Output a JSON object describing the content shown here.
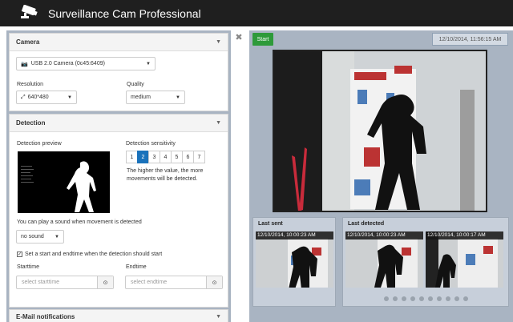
{
  "app": {
    "title": "Surveillance Cam Professional"
  },
  "camera": {
    "header": "Camera",
    "device": "USB 2.0 Camera (0c45:6409)",
    "resolution_label": "Resolution",
    "resolution": "640*480",
    "quality_label": "Quality",
    "quality": "medium"
  },
  "detection": {
    "header": "Detection",
    "preview_label": "Detection preview",
    "sensitivity_label": "Detection sensitivity",
    "sensitivity_options": [
      "1",
      "2",
      "3",
      "4",
      "5",
      "6",
      "7"
    ],
    "sensitivity_selected": "2",
    "hint": "The higher the value, the more movements will be detected.",
    "sound_hint": "You can play a sound when movement is detected",
    "sound": "no sound",
    "checkbox_label": "Set a start and endtime when the detection should start",
    "starttime_label": "Starttime",
    "starttime_placeholder": "select starttime",
    "endtime_label": "Endtime",
    "endtime_placeholder": "select endtime"
  },
  "email": {
    "header": "E-Mail notifications"
  },
  "live": {
    "start_label": "Start",
    "timestamp": "12/10/2014, 11:56:15 AM"
  },
  "last_sent": {
    "title": "Last sent",
    "thumb_time": "12/10/2014, 10:00:23 AM"
  },
  "last_detected": {
    "title": "Last detected",
    "thumbs": [
      "12/10/2014, 10:00:23 AM",
      "12/10/2014, 10:00:17 AM"
    ]
  },
  "colors": {
    "accent": "#1a72bb",
    "start": "#2e9a3a",
    "panel": "#a9b4c2"
  }
}
